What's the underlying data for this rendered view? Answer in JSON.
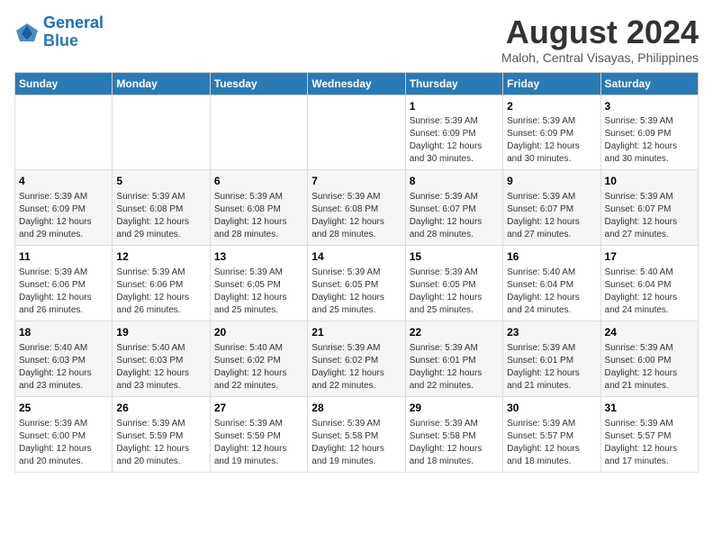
{
  "header": {
    "logo_line1": "General",
    "logo_line2": "Blue",
    "main_title": "August 2024",
    "subtitle": "Maloh, Central Visayas, Philippines"
  },
  "days_of_week": [
    "Sunday",
    "Monday",
    "Tuesday",
    "Wednesday",
    "Thursday",
    "Friday",
    "Saturday"
  ],
  "weeks": [
    {
      "cells": [
        {
          "day": "",
          "info": ""
        },
        {
          "day": "",
          "info": ""
        },
        {
          "day": "",
          "info": ""
        },
        {
          "day": "",
          "info": ""
        },
        {
          "day": "1",
          "info": "Sunrise: 5:39 AM\nSunset: 6:09 PM\nDaylight: 12 hours and 30 minutes."
        },
        {
          "day": "2",
          "info": "Sunrise: 5:39 AM\nSunset: 6:09 PM\nDaylight: 12 hours and 30 minutes."
        },
        {
          "day": "3",
          "info": "Sunrise: 5:39 AM\nSunset: 6:09 PM\nDaylight: 12 hours and 30 minutes."
        }
      ]
    },
    {
      "cells": [
        {
          "day": "4",
          "info": "Sunrise: 5:39 AM\nSunset: 6:09 PM\nDaylight: 12 hours and 29 minutes."
        },
        {
          "day": "5",
          "info": "Sunrise: 5:39 AM\nSunset: 6:08 PM\nDaylight: 12 hours and 29 minutes."
        },
        {
          "day": "6",
          "info": "Sunrise: 5:39 AM\nSunset: 6:08 PM\nDaylight: 12 hours and 28 minutes."
        },
        {
          "day": "7",
          "info": "Sunrise: 5:39 AM\nSunset: 6:08 PM\nDaylight: 12 hours and 28 minutes."
        },
        {
          "day": "8",
          "info": "Sunrise: 5:39 AM\nSunset: 6:07 PM\nDaylight: 12 hours and 28 minutes."
        },
        {
          "day": "9",
          "info": "Sunrise: 5:39 AM\nSunset: 6:07 PM\nDaylight: 12 hours and 27 minutes."
        },
        {
          "day": "10",
          "info": "Sunrise: 5:39 AM\nSunset: 6:07 PM\nDaylight: 12 hours and 27 minutes."
        }
      ]
    },
    {
      "cells": [
        {
          "day": "11",
          "info": "Sunrise: 5:39 AM\nSunset: 6:06 PM\nDaylight: 12 hours and 26 minutes."
        },
        {
          "day": "12",
          "info": "Sunrise: 5:39 AM\nSunset: 6:06 PM\nDaylight: 12 hours and 26 minutes."
        },
        {
          "day": "13",
          "info": "Sunrise: 5:39 AM\nSunset: 6:05 PM\nDaylight: 12 hours and 25 minutes."
        },
        {
          "day": "14",
          "info": "Sunrise: 5:39 AM\nSunset: 6:05 PM\nDaylight: 12 hours and 25 minutes."
        },
        {
          "day": "15",
          "info": "Sunrise: 5:39 AM\nSunset: 6:05 PM\nDaylight: 12 hours and 25 minutes."
        },
        {
          "day": "16",
          "info": "Sunrise: 5:40 AM\nSunset: 6:04 PM\nDaylight: 12 hours and 24 minutes."
        },
        {
          "day": "17",
          "info": "Sunrise: 5:40 AM\nSunset: 6:04 PM\nDaylight: 12 hours and 24 minutes."
        }
      ]
    },
    {
      "cells": [
        {
          "day": "18",
          "info": "Sunrise: 5:40 AM\nSunset: 6:03 PM\nDaylight: 12 hours and 23 minutes."
        },
        {
          "day": "19",
          "info": "Sunrise: 5:40 AM\nSunset: 6:03 PM\nDaylight: 12 hours and 23 minutes."
        },
        {
          "day": "20",
          "info": "Sunrise: 5:40 AM\nSunset: 6:02 PM\nDaylight: 12 hours and 22 minutes."
        },
        {
          "day": "21",
          "info": "Sunrise: 5:39 AM\nSunset: 6:02 PM\nDaylight: 12 hours and 22 minutes."
        },
        {
          "day": "22",
          "info": "Sunrise: 5:39 AM\nSunset: 6:01 PM\nDaylight: 12 hours and 22 minutes."
        },
        {
          "day": "23",
          "info": "Sunrise: 5:39 AM\nSunset: 6:01 PM\nDaylight: 12 hours and 21 minutes."
        },
        {
          "day": "24",
          "info": "Sunrise: 5:39 AM\nSunset: 6:00 PM\nDaylight: 12 hours and 21 minutes."
        }
      ]
    },
    {
      "cells": [
        {
          "day": "25",
          "info": "Sunrise: 5:39 AM\nSunset: 6:00 PM\nDaylight: 12 hours and 20 minutes."
        },
        {
          "day": "26",
          "info": "Sunrise: 5:39 AM\nSunset: 5:59 PM\nDaylight: 12 hours and 20 minutes."
        },
        {
          "day": "27",
          "info": "Sunrise: 5:39 AM\nSunset: 5:59 PM\nDaylight: 12 hours and 19 minutes."
        },
        {
          "day": "28",
          "info": "Sunrise: 5:39 AM\nSunset: 5:58 PM\nDaylight: 12 hours and 19 minutes."
        },
        {
          "day": "29",
          "info": "Sunrise: 5:39 AM\nSunset: 5:58 PM\nDaylight: 12 hours and 18 minutes."
        },
        {
          "day": "30",
          "info": "Sunrise: 5:39 AM\nSunset: 5:57 PM\nDaylight: 12 hours and 18 minutes."
        },
        {
          "day": "31",
          "info": "Sunrise: 5:39 AM\nSunset: 5:57 PM\nDaylight: 12 hours and 17 minutes."
        }
      ]
    }
  ]
}
